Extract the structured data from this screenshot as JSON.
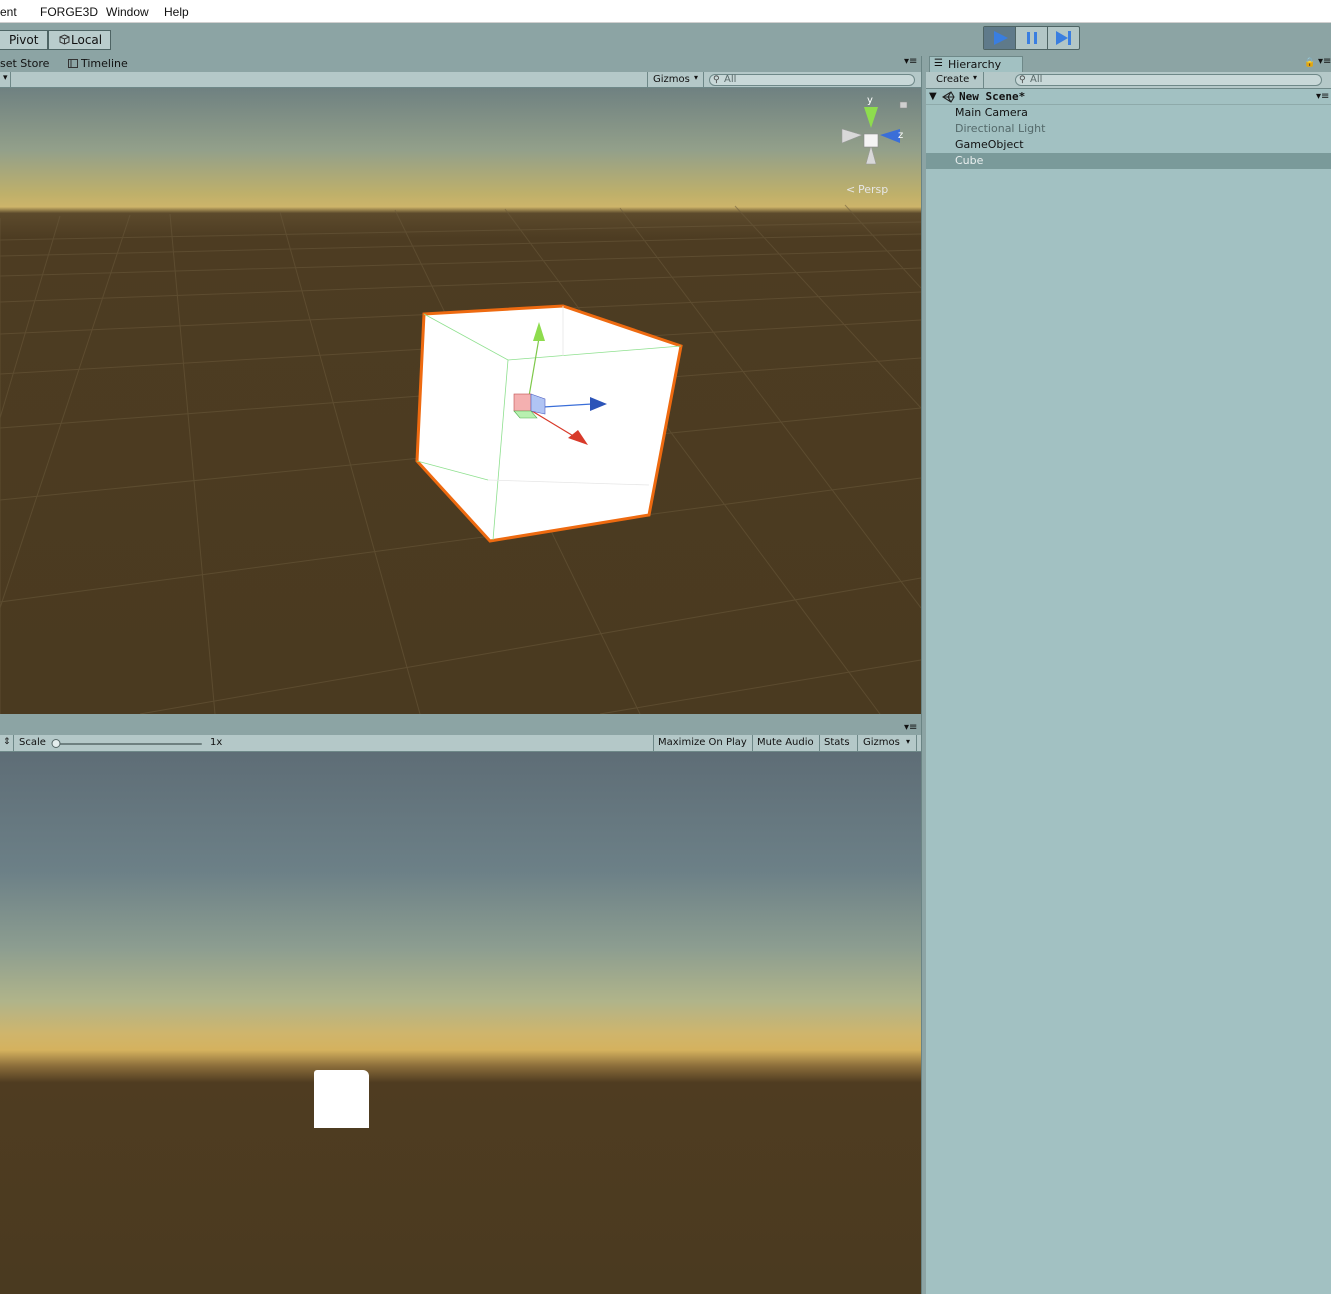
{
  "menu": {
    "item1": "ent",
    "item2": "FORGE3D",
    "item3": "Window",
    "item4": "Help"
  },
  "toolbar": {
    "pivot_label": "Pivot",
    "local_label": "Local"
  },
  "scene_tabs": {
    "asset_store": "set Store",
    "timeline": "Timeline"
  },
  "scene_toolbar": {
    "gizmos_label": "Gizmos",
    "search_placeholder": "All"
  },
  "scene_view": {
    "persp_label": "Persp",
    "axis_y": "y",
    "axis_z": "z"
  },
  "game_toolbar": {
    "scale_label": "Scale",
    "scale_value": "1x",
    "scale_slider_value": 0,
    "maximize_label": "Maximize On Play",
    "mute_label": "Mute Audio",
    "stats_label": "Stats",
    "gizmos_label": "Gizmos"
  },
  "hierarchy": {
    "tab_label": "Hierarchy",
    "create_label": "Create",
    "search_placeholder": "All",
    "scene_name": "New Scene*",
    "items": [
      {
        "label": "Main Camera",
        "state": "normal"
      },
      {
        "label": "Directional Light",
        "state": "dimmed"
      },
      {
        "label": "GameObject",
        "state": "normal"
      },
      {
        "label": "Cube",
        "state": "selected"
      }
    ]
  },
  "colors": {
    "panel_bg": "#a2c1c2",
    "toolbar_bg": "#8ca4a4",
    "selection": "#7a9a9a",
    "play_active": "#3a7ee0",
    "cube_outline": "#ee6a10",
    "ground": "#4a3a20"
  }
}
